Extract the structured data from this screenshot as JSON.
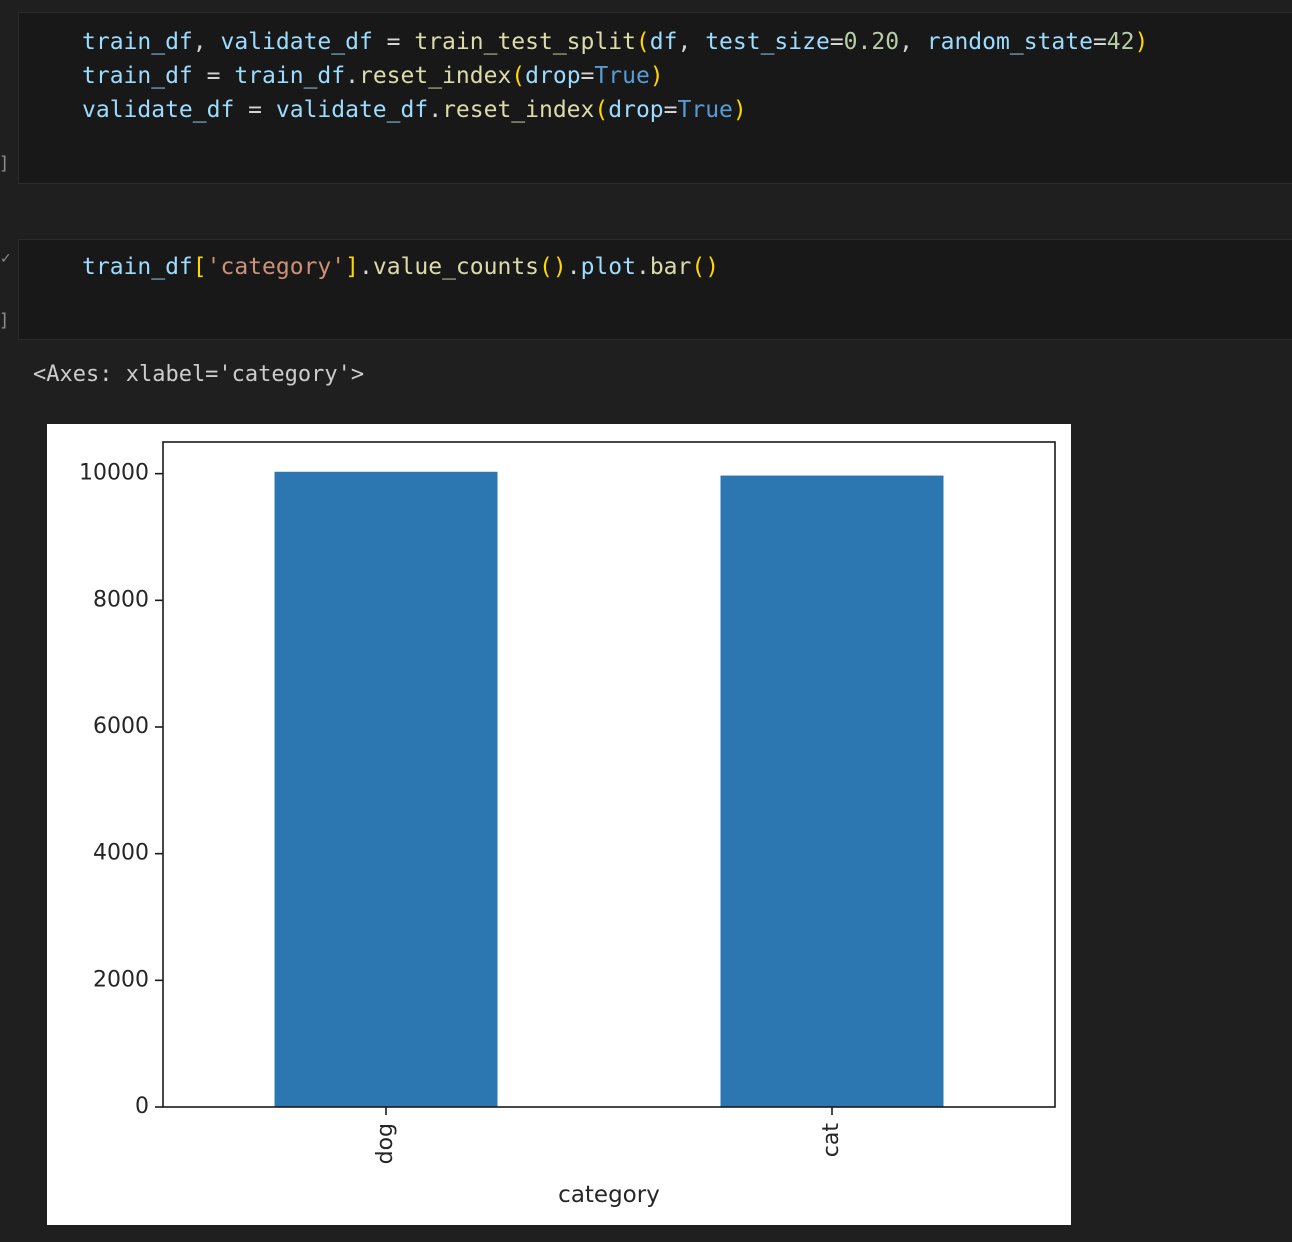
{
  "cells": [
    {
      "lines": [
        [
          [
            "v",
            "train_df"
          ],
          [
            "o",
            ", "
          ],
          [
            "v",
            "validate_df"
          ],
          [
            "o",
            " = "
          ],
          [
            "f",
            "train_test_split"
          ],
          [
            "b",
            "("
          ],
          [
            "v",
            "df"
          ],
          [
            "o",
            ", "
          ],
          [
            "v",
            "test_size"
          ],
          [
            "o",
            "="
          ],
          [
            "n",
            "0.20"
          ],
          [
            "o",
            ", "
          ],
          [
            "v",
            "random_state"
          ],
          [
            "o",
            "="
          ],
          [
            "n",
            "42"
          ],
          [
            "b",
            ")"
          ]
        ],
        [
          [
            "v",
            "train_df"
          ],
          [
            "o",
            " = "
          ],
          [
            "v",
            "train_df"
          ],
          [
            "o",
            "."
          ],
          [
            "f",
            "reset_index"
          ],
          [
            "b",
            "("
          ],
          [
            "v",
            "drop"
          ],
          [
            "o",
            "="
          ],
          [
            "k",
            "True"
          ],
          [
            "b",
            ")"
          ]
        ],
        [
          [
            "v",
            "validate_df"
          ],
          [
            "o",
            " = "
          ],
          [
            "v",
            "validate_df"
          ],
          [
            "o",
            "."
          ],
          [
            "f",
            "reset_index"
          ],
          [
            "b",
            "("
          ],
          [
            "v",
            "drop"
          ],
          [
            "o",
            "="
          ],
          [
            "k",
            "True"
          ],
          [
            "b",
            ")"
          ]
        ]
      ]
    },
    {
      "lines": [
        [
          [
            "v",
            "train_df"
          ],
          [
            "b",
            "["
          ],
          [
            "s",
            "'category'"
          ],
          [
            "b",
            "]"
          ],
          [
            "o",
            "."
          ],
          [
            "f",
            "value_counts"
          ],
          [
            "b",
            "()"
          ],
          [
            "o",
            "."
          ],
          [
            "v",
            "plot"
          ],
          [
            "o",
            "."
          ],
          [
            "f",
            "bar"
          ],
          [
            "b",
            "()"
          ]
        ]
      ]
    }
  ],
  "output": {
    "repr": "<Axes: xlabel='category'>"
  },
  "chart_data": {
    "type": "bar",
    "categories": [
      "dog",
      "cat"
    ],
    "values": [
      10030,
      9970
    ],
    "xlabel": "category",
    "ylabel": "",
    "ylim": [
      0,
      10500
    ],
    "yticks": [
      0,
      2000,
      4000,
      6000,
      8000,
      10000
    ],
    "bar_color": "#2c76b1",
    "grid": false,
    "legend": false
  }
}
